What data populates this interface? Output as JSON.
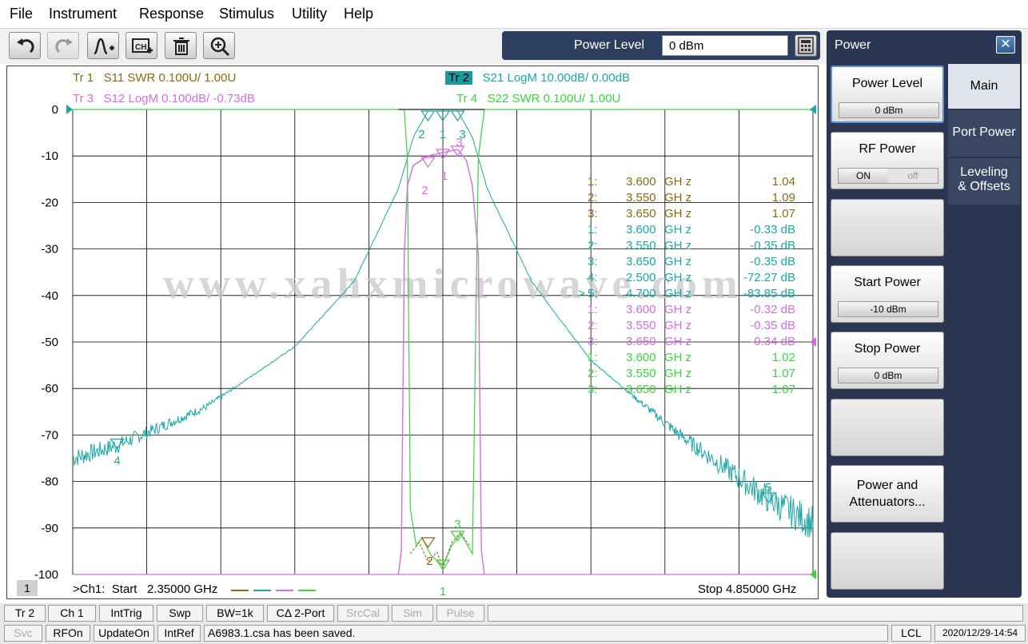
{
  "menu": [
    "File",
    "Instrument",
    "Response",
    "Stimulus",
    "Utility",
    "Help"
  ],
  "toolbar": {
    "buttons": [
      "undo-icon",
      "redo-icon",
      "add-trace-icon",
      "add-channel-icon",
      "delete-icon",
      "zoom-icon"
    ]
  },
  "entry": {
    "label": "Power Level",
    "value": "0 dBm"
  },
  "traces": [
    {
      "id": "Tr 1",
      "text": "S11 SWR 0.100U/  1.00U",
      "color": "#8b6914"
    },
    {
      "id": "Tr 2",
      "text": "S21 LogM 10.00dB/  0.00dB",
      "color": "#1aa7a7"
    },
    {
      "id": "Tr 3",
      "text": "S12 LogM 0.100dB/  -0.73dB",
      "color": "#d36ee0"
    },
    {
      "id": "Tr 4",
      "text": "S22 SWR 0.100U/  1.00U",
      "color": "#3ed23e"
    }
  ],
  "yticks": [
    "0",
    "-10",
    "-20",
    "-30",
    "-40",
    "-50",
    "-60",
    "-70",
    "-80",
    "-90",
    "-100"
  ],
  "footer": {
    "channel_num": "1",
    "start": ">Ch1:  Start   2.35000 GHz",
    "stop": "Stop  4.85000 GHz"
  },
  "watermark": "www.xahxmicrowave.com",
  "marker_table": [
    {
      "num": "1:",
      "arrow": "",
      "freq": "3.600",
      "unit": "GH z",
      "value": "1.04",
      "trace": 0
    },
    {
      "num": "2:",
      "arrow": "",
      "freq": "3.550",
      "unit": "GH z",
      "value": "1.09",
      "trace": 0
    },
    {
      "num": "3:",
      "arrow": "",
      "freq": "3.650",
      "unit": "GH z",
      "value": "1.07",
      "trace": 0
    },
    {
      "num": "1:",
      "arrow": "",
      "freq": "3.600",
      "unit": "GH z",
      "value": "-0.33 dB",
      "trace": 1
    },
    {
      "num": "2:",
      "arrow": "",
      "freq": "3.550",
      "unit": "GH z",
      "value": "-0.35 dB",
      "trace": 1
    },
    {
      "num": "3:",
      "arrow": "",
      "freq": "3.650",
      "unit": "GH z",
      "value": "-0.35 dB",
      "trace": 1
    },
    {
      "num": "4:",
      "arrow": "",
      "freq": "2.500",
      "unit": "GH z",
      "value": "-72.27 dB",
      "trace": 1
    },
    {
      "num": "5:",
      "arrow": ">",
      "freq": "4.700",
      "unit": "GH z",
      "value": "-83.85 dB",
      "trace": 1
    },
    {
      "num": "1:",
      "arrow": "",
      "freq": "3.600",
      "unit": "GH z",
      "value": "-0.32 dB",
      "trace": 2
    },
    {
      "num": "2:",
      "arrow": "",
      "freq": "3.550",
      "unit": "GH z",
      "value": "-0.35 dB",
      "trace": 2
    },
    {
      "num": "3:",
      "arrow": "",
      "freq": "3.650",
      "unit": "GH z",
      "value": "-0.34 dB",
      "trace": 2
    },
    {
      "num": "1:",
      "arrow": "",
      "freq": "3.600",
      "unit": "GH z",
      "value": "1.02",
      "trace": 3
    },
    {
      "num": "2:",
      "arrow": "",
      "freq": "3.550",
      "unit": "GH z",
      "value": "1.07",
      "trace": 3
    },
    {
      "num": "3:",
      "arrow": "",
      "freq": "3.650",
      "unit": "GH z",
      "value": "1.07",
      "trace": 3
    }
  ],
  "chart_data": {
    "type": "line",
    "x_range_ghz": [
      2.35,
      4.85
    ],
    "ylim_s21_db": [
      -100,
      0
    ],
    "series": [
      {
        "name": "S21 LogM",
        "x": [
          2.35,
          2.5,
          2.8,
          3.1,
          3.3,
          3.45,
          3.5,
          3.55,
          3.6,
          3.65,
          3.7,
          3.75,
          3.9,
          4.1,
          4.4,
          4.7,
          4.85
        ],
        "y": [
          -75,
          -72.27,
          -64,
          -51,
          -37,
          -17,
          -6,
          -0.35,
          -0.33,
          -0.35,
          -6,
          -17,
          -37,
          -54,
          -70,
          -83.85,
          -89
        ]
      },
      {
        "name": "S12 LogM",
        "x": [
          3.5,
          3.52,
          3.55,
          3.6,
          3.65,
          3.67,
          3.7
        ],
        "y": [
          -1.4,
          -0.6,
          -0.35,
          -0.32,
          -0.34,
          -0.6,
          -1.4
        ]
      },
      {
        "name": "S11 SWR",
        "x": [
          3.55,
          3.6,
          3.65
        ],
        "y": [
          1.09,
          1.04,
          1.07
        ]
      },
      {
        "name": "S22 SWR",
        "x": [
          3.55,
          3.6,
          3.65
        ],
        "y": [
          1.07,
          1.02,
          1.07
        ]
      }
    ],
    "marker_labels": [
      "1",
      "2",
      "3",
      "4",
      "5"
    ],
    "grid": true
  },
  "panel": {
    "title": "Power",
    "softkeys": [
      {
        "label": "Power Level",
        "value": "0 dBm"
      },
      {
        "label": "RF Power",
        "on": "ON",
        "off": "off"
      },
      {
        "label": ""
      },
      {
        "label": "Start Power",
        "value": "-10 dBm"
      },
      {
        "label": "Stop Power",
        "value": "0 dBm"
      },
      {
        "label": ""
      },
      {
        "label1": "Power and",
        "label2": "Attenuators..."
      },
      {
        "label": ""
      }
    ],
    "tabs": [
      "Main",
      "Port Power",
      "Leveling",
      "& Offsets"
    ]
  },
  "status_row1": [
    "Tr 2",
    "Ch 1",
    "IntTrig",
    "Swp",
    "BW=1k",
    "CΔ 2-Port",
    "SrcCal",
    "Sim",
    "Pulse"
  ],
  "status_row2": [
    "Svc",
    "RFOn",
    "UpdateOn",
    "IntRef",
    "A6983.1.csa has been saved.",
    "LCL",
    "2020/12/29-14:54"
  ]
}
